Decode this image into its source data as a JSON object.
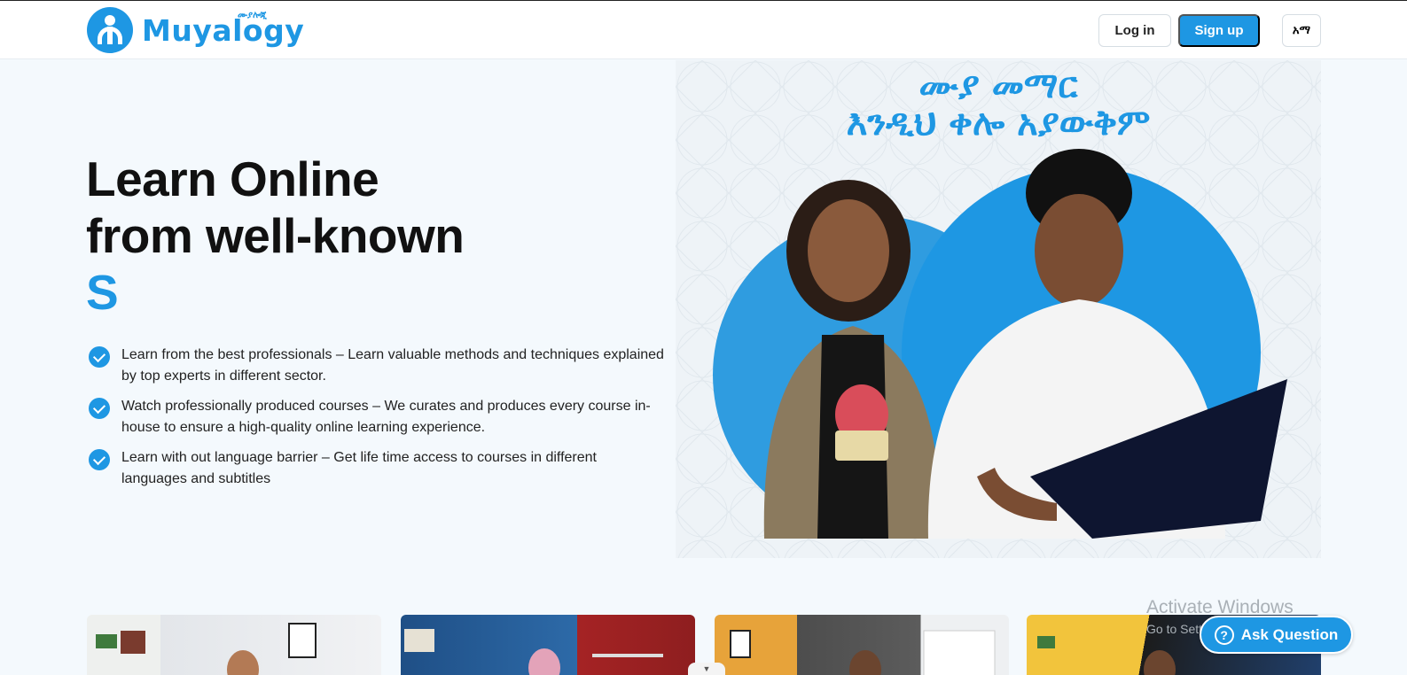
{
  "header": {
    "brand": "Muyalogy",
    "brand_sub": "ሙያሎጂ",
    "login_label": "Log in",
    "signup_label": "Sign up",
    "language_label": "አማ"
  },
  "hero": {
    "title_line1": "Learn Online",
    "title_line2": "from well-known",
    "title_accent": "S",
    "image_text_line1": "ሙያ መማር",
    "image_text_line2": "እንዲህ ቀሎ አያውቅም",
    "features": [
      "Learn from the best professionals – Learn valuable methods and techniques explained by top experts in different sector.",
      "Watch professionally produced courses – We curates and produces every course in-house to ensure a high-quality online learning experience.",
      "Learn with out language barrier – Get life time access to courses in different languages and subtitles"
    ]
  },
  "overlay": {
    "activate_title": "Activate Windows",
    "activate_sub": "Go to Settings to activate Windows.",
    "ask_label": "Ask Question",
    "ask_icon": "?"
  },
  "colors": {
    "brand": "#1e97e3",
    "background": "#f4f9fd"
  }
}
